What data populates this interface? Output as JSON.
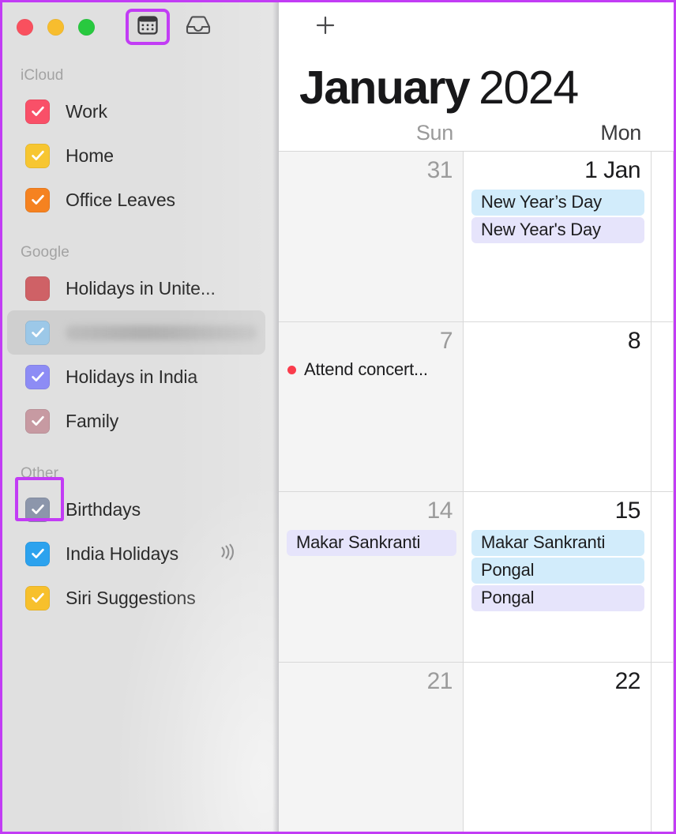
{
  "window": {
    "traffic_lights": [
      {
        "name": "close",
        "color": "#f9505e"
      },
      {
        "name": "minimize",
        "color": "#f7bd2e"
      },
      {
        "name": "zoom",
        "color": "#28c93f"
      }
    ],
    "toolbar": {
      "calendar_view_icon": "calendar-icon",
      "inbox_icon": "inbox-tray-icon",
      "add_icon": "plus-icon"
    }
  },
  "sidebar": {
    "sections": [
      {
        "title": "iCloud",
        "items": [
          {
            "label": "Work",
            "color": "#f95068",
            "checked": true,
            "selected": false,
            "redacted": false,
            "highlighted": false,
            "subscribed": false
          },
          {
            "label": "Home",
            "color": "#f7c631",
            "checked": true,
            "selected": false,
            "redacted": false,
            "highlighted": false,
            "subscribed": false
          },
          {
            "label": "Office Leaves",
            "color": "#f58220",
            "checked": true,
            "selected": false,
            "redacted": false,
            "highlighted": false,
            "subscribed": false
          }
        ]
      },
      {
        "title": "Google",
        "items": [
          {
            "label": "Holidays in Unite...",
            "color": "#cf6166",
            "checked": false,
            "selected": false,
            "redacted": false,
            "highlighted": false,
            "subscribed": false
          },
          {
            "label": "",
            "color": "#9cc8e8",
            "checked": true,
            "selected": true,
            "redacted": true,
            "highlighted": false,
            "subscribed": false
          },
          {
            "label": "Holidays in India",
            "color": "#8d8cf5",
            "checked": true,
            "selected": false,
            "redacted": false,
            "highlighted": false,
            "subscribed": false
          },
          {
            "label": "Family",
            "color": "#c79aa2",
            "checked": true,
            "selected": false,
            "redacted": false,
            "highlighted": false,
            "subscribed": false
          }
        ]
      },
      {
        "title": "Other",
        "items": [
          {
            "label": "Birthdays",
            "color": "#8c96ab",
            "checked": true,
            "selected": false,
            "redacted": false,
            "highlighted": true,
            "subscribed": false
          },
          {
            "label": "India Holidays",
            "color": "#2ca2ee",
            "checked": true,
            "selected": false,
            "redacted": false,
            "highlighted": false,
            "subscribed": true
          },
          {
            "label": "Siri Suggestions",
            "color": "#f7c02c",
            "checked": true,
            "selected": false,
            "redacted": false,
            "highlighted": false,
            "subscribed": false
          }
        ]
      }
    ]
  },
  "calendar": {
    "month": "January",
    "year": "2024",
    "weekdays": [
      {
        "label": "Sun",
        "dim": true
      },
      {
        "label": "Mon",
        "dim": false
      }
    ],
    "weeks": [
      {
        "days": [
          {
            "num": "31",
            "dim": true,
            "shaded": true,
            "events": []
          },
          {
            "num": "1 Jan",
            "dim": false,
            "shaded": false,
            "events": [
              {
                "title": "New Year’s Day",
                "style": "pill",
                "bg": "#d2ecfb"
              },
              {
                "title": "New Year's Day",
                "style": "pill",
                "bg": "#e6e4fb"
              }
            ]
          },
          {
            "num": "",
            "dim": false,
            "shaded": false,
            "events": []
          }
        ]
      },
      {
        "days": [
          {
            "num": "7",
            "dim": true,
            "shaded": true,
            "events": [
              {
                "title": "Attend concert...",
                "style": "dot",
                "bg": "#fa3c4c"
              }
            ]
          },
          {
            "num": "8",
            "dim": false,
            "shaded": false,
            "events": []
          },
          {
            "num": "",
            "dim": false,
            "shaded": false,
            "events": []
          }
        ]
      },
      {
        "days": [
          {
            "num": "14",
            "dim": true,
            "shaded": true,
            "events": [
              {
                "title": "Makar Sankranti",
                "style": "pill",
                "bg": "#e6e4fb"
              }
            ]
          },
          {
            "num": "15",
            "dim": false,
            "shaded": false,
            "events": [
              {
                "title": "Makar Sankranti",
                "style": "pill",
                "bg": "#d2ecfb"
              },
              {
                "title": "Pongal",
                "style": "pill",
                "bg": "#d2ecfb"
              },
              {
                "title": "Pongal",
                "style": "pill",
                "bg": "#e6e4fb"
              }
            ]
          },
          {
            "num": "",
            "dim": false,
            "shaded": false,
            "events": []
          }
        ]
      },
      {
        "days": [
          {
            "num": "21",
            "dim": true,
            "shaded": true,
            "events": []
          },
          {
            "num": "22",
            "dim": false,
            "shaded": false,
            "events": []
          },
          {
            "num": "",
            "dim": false,
            "shaded": false,
            "events": []
          }
        ]
      }
    ]
  },
  "annotation": {
    "highlight_color": "#c23cf5"
  }
}
